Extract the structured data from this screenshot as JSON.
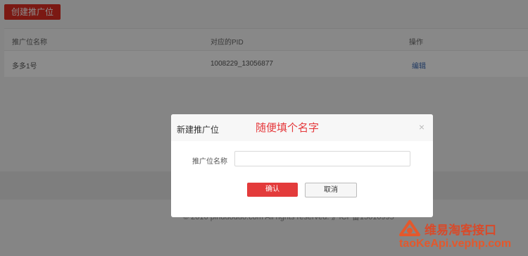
{
  "toolbar": {
    "create_label": "创建推广位"
  },
  "table": {
    "headers": [
      "推广位名称",
      "对应的PID",
      "操作"
    ],
    "rows": [
      {
        "name": "多多1号",
        "pid": "1008229_13056877",
        "action": "编辑"
      }
    ]
  },
  "footer": {
    "copyright": "© 2016 pinduoduo.com All rights reserved. 沪ICP备15016995"
  },
  "dialog": {
    "title": "新建推广位",
    "annotation": "随便填个名字",
    "close_symbol": "×",
    "field_label": "推广位名称",
    "field_value": "",
    "confirm_label": "确认",
    "cancel_label": "取消"
  },
  "watermark": {
    "line1": "维易淘客接口",
    "line2": "taoKeApi.vephp.com"
  },
  "colors": {
    "accent": "#e02e24",
    "link": "#3d6bb3",
    "annotation": "#e5393c"
  }
}
